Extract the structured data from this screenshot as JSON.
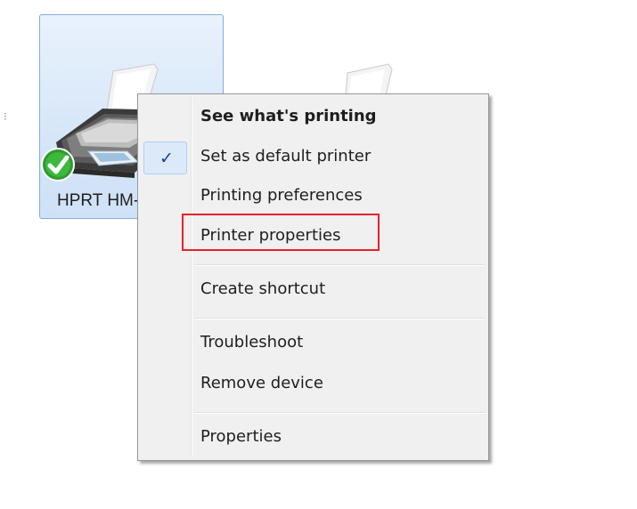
{
  "device": {
    "label": "HPRT HM-",
    "status_icon": "green-checkmark-icon",
    "icon": "printer-icon"
  },
  "device2": {
    "icon": "printer-icon"
  },
  "menu": {
    "items": [
      {
        "label": "See what's printing",
        "bold": true
      },
      {
        "label": "Set as default printer",
        "checked": true,
        "check_glyph": "✓"
      },
      {
        "label": "Printing preferences"
      },
      {
        "label": "Printer properties",
        "highlighted": true
      },
      {
        "label": "Create shortcut"
      },
      {
        "label": "Troubleshoot"
      },
      {
        "label": "Remove device"
      },
      {
        "label": "Properties"
      }
    ]
  },
  "annotation": {
    "highlight_color": "#e8202a"
  },
  "colors": {
    "menu_background": "#f0f0f0",
    "selection_tile": "#d6e6f8",
    "check_color": "#1a3f9b"
  }
}
